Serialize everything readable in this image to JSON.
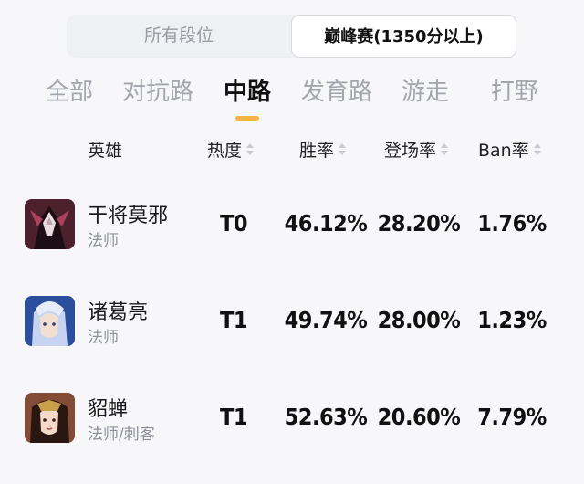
{
  "rank_toggle": {
    "options": [
      "所有段位",
      "巅峰赛(1350分以上)"
    ],
    "selected": "巅峰赛(1350分以上)"
  },
  "lane_tabs": {
    "items": [
      "全部",
      "对抗路",
      "中路",
      "发育路",
      "游走",
      "打野"
    ],
    "active": "中路"
  },
  "table": {
    "columns": [
      "英雄",
      "热度",
      "胜率",
      "登场率",
      "Ban率"
    ],
    "rows": [
      {
        "name": "干将莫邪",
        "role": "法师",
        "tier": "T0",
        "win_rate": "46.12%",
        "pick_rate": "28.20%",
        "ban_rate": "1.76%"
      },
      {
        "name": "诸葛亮",
        "role": "法师",
        "tier": "T1",
        "win_rate": "49.74%",
        "pick_rate": "28.00%",
        "ban_rate": "1.23%"
      },
      {
        "name": "貂蝉",
        "role": "法师/刺客",
        "tier": "T1",
        "win_rate": "52.63%",
        "pick_rate": "20.60%",
        "ban_rate": "7.79%"
      }
    ]
  },
  "colors": {
    "accent_indicator": "#f3b445",
    "background": "#f7f7f9",
    "inactive_tab": "#a3a6ad"
  }
}
